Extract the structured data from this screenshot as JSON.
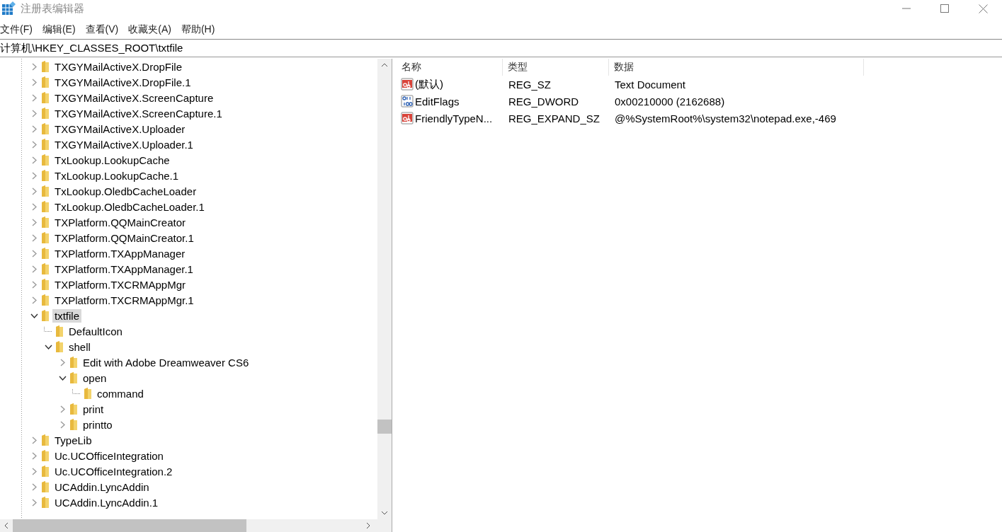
{
  "window": {
    "title": "注册表编辑器"
  },
  "menu": [
    "文件(F)",
    "编辑(E)",
    "查看(V)",
    "收藏夹(A)",
    "帮助(H)"
  ],
  "address": "计算机\\HKEY_CLASSES_ROOT\\txtfile",
  "tree": [
    {
      "label": "TXGYMailActiveX.DropFile",
      "kind": "collapsed",
      "selected": false
    },
    {
      "label": "TXGYMailActiveX.DropFile.1",
      "kind": "collapsed",
      "selected": false
    },
    {
      "label": "TXGYMailActiveX.ScreenCapture",
      "kind": "collapsed",
      "selected": false
    },
    {
      "label": "TXGYMailActiveX.ScreenCapture.1",
      "kind": "collapsed",
      "selected": false
    },
    {
      "label": "TXGYMailActiveX.Uploader",
      "kind": "collapsed",
      "selected": false
    },
    {
      "label": "TXGYMailActiveX.Uploader.1",
      "kind": "collapsed",
      "selected": false
    },
    {
      "label": "TxLookup.LookupCache",
      "kind": "collapsed",
      "selected": false
    },
    {
      "label": "TxLookup.LookupCache.1",
      "kind": "collapsed",
      "selected": false
    },
    {
      "label": "TxLookup.OledbCacheLoader",
      "kind": "collapsed",
      "selected": false
    },
    {
      "label": "TxLookup.OledbCacheLoader.1",
      "kind": "collapsed",
      "selected": false
    },
    {
      "label": "TXPlatform.QQMainCreator",
      "kind": "collapsed",
      "selected": false
    },
    {
      "label": "TXPlatform.QQMainCreator.1",
      "kind": "collapsed",
      "selected": false
    },
    {
      "label": "TXPlatform.TXAppManager",
      "kind": "collapsed",
      "selected": false
    },
    {
      "label": "TXPlatform.TXAppManager.1",
      "kind": "collapsed",
      "selected": false
    },
    {
      "label": "TXPlatform.TXCRMAppMgr",
      "kind": "collapsed",
      "selected": false
    },
    {
      "label": "TXPlatform.TXCRMAppMgr.1",
      "kind": "collapsed",
      "selected": false
    },
    {
      "label": "txtfile",
      "kind": "expanded",
      "selected": true,
      "children": [
        {
          "label": "DefaultIcon",
          "kind": "leaf",
          "selected": false
        },
        {
          "label": "shell",
          "kind": "expanded",
          "selected": false,
          "children": [
            {
              "label": "Edit with Adobe Dreamweaver CS6",
              "kind": "collapsed",
              "selected": false
            },
            {
              "label": "open",
              "kind": "expanded",
              "selected": false,
              "children": [
                {
                  "label": "command",
                  "kind": "leaf",
                  "selected": false
                }
              ]
            },
            {
              "label": "print",
              "kind": "collapsed",
              "selected": false
            },
            {
              "label": "printto",
              "kind": "collapsed",
              "selected": false
            }
          ]
        }
      ]
    },
    {
      "label": "TypeLib",
      "kind": "collapsed",
      "selected": false
    },
    {
      "label": "Uc.UCOfficeIntegration",
      "kind": "collapsed",
      "selected": false
    },
    {
      "label": "Uc.UCOfficeIntegration.2",
      "kind": "collapsed",
      "selected": false
    },
    {
      "label": "UCAddin.LyncAddin",
      "kind": "collapsed",
      "selected": false
    },
    {
      "label": "UCAddin.LyncAddin.1",
      "kind": "collapsed",
      "selected": false
    }
  ],
  "values": {
    "columns": [
      "名称",
      "类型",
      "数据"
    ],
    "rows": [
      {
        "name": "(默认)",
        "type": "REG_SZ",
        "data": "Text Document",
        "kind": "string"
      },
      {
        "name": "EditFlags",
        "type": "REG_DWORD",
        "data": "0x00210000 (2162688)",
        "kind": "binary"
      },
      {
        "name": "FriendlyTypeN...",
        "type": "REG_EXPAND_SZ",
        "data": "@%SystemRoot%\\system32\\notepad.exe,-469",
        "kind": "string"
      }
    ]
  }
}
